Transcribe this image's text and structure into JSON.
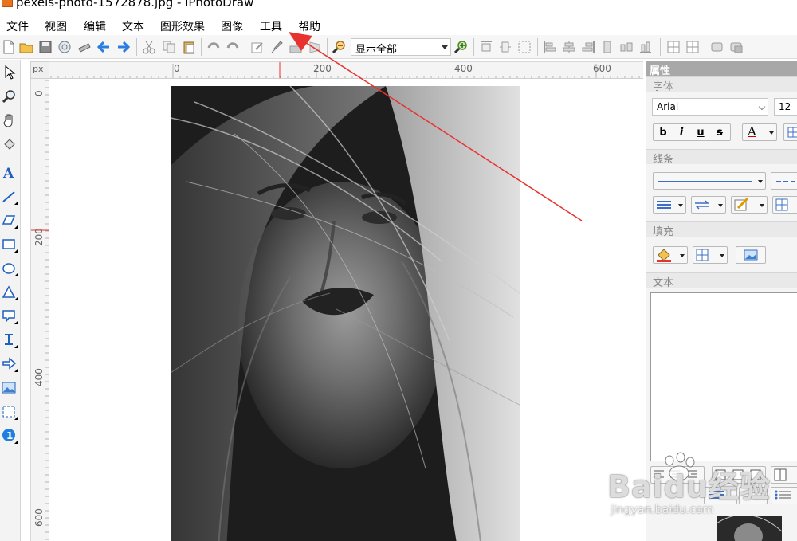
{
  "window": {
    "title": "pexels-photo-1572878.jpg - iPhotoDraw"
  },
  "menu": [
    "文件",
    "视图",
    "编辑",
    "文本",
    "图形效果",
    "图像",
    "工具",
    "帮助"
  ],
  "toolbar": {
    "zoom_value": "显示全部"
  },
  "ruler": {
    "unit": "px",
    "h_labels": [
      "0",
      "200",
      "400",
      "600"
    ],
    "v_labels": [
      "0",
      "200",
      "400",
      "600"
    ]
  },
  "properties_panel": {
    "title": "属性",
    "font_section": "字体",
    "font_name": "Arial",
    "font_size": "12",
    "format_buttons": [
      "b",
      "i",
      "u",
      "s"
    ],
    "font_color_glyph": "A",
    "line_section": "线条",
    "fill_section": "填充",
    "text_section": "文本"
  },
  "watermark": {
    "logo": "Baidu经验",
    "url": "jingyan.baidu.com"
  },
  "colors": {
    "annotation_arrow": "#e8322f",
    "panel_title_bg": "#a8a8a8",
    "toolbar_blue": "#2a7de1"
  },
  "icons": {
    "left_tools": [
      "pointer-icon",
      "zoom-icon",
      "hand-icon",
      "fill-bucket-icon",
      "text-tool-icon",
      "line-tool-icon",
      "polygon-tool-icon",
      "rectangle-tool-icon",
      "ellipse-tool-icon",
      "triangle-tool-icon",
      "callout-tool-icon",
      "connector-tool-icon",
      "arrow-shape-icon",
      "image-tool-icon",
      "crop-tool-icon",
      "number-tool-icon"
    ]
  }
}
